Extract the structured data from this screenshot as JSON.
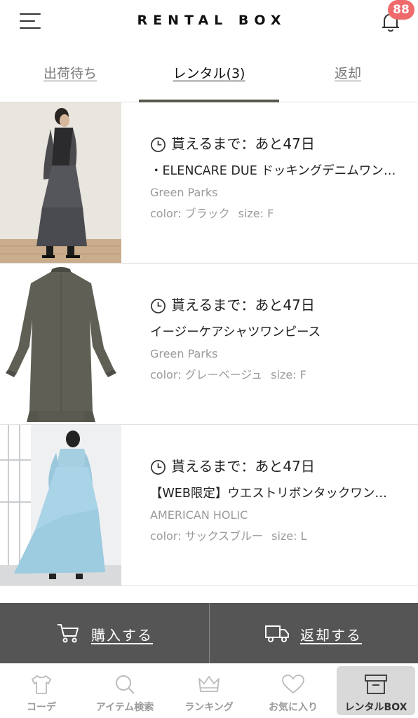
{
  "header": {
    "title": "RENTAL BOX",
    "notification_count": "88"
  },
  "tabs": [
    {
      "label": "出荷待ち"
    },
    {
      "label": "レンタル(3)"
    },
    {
      "label": "返却"
    }
  ],
  "items": [
    {
      "deadline": "貰えるまで：あと47日",
      "name": "・ELENCARE DUE ドッキングデニムワンピース",
      "brand": "Green Parks",
      "color": "color: ブラック",
      "size": "size: F"
    },
    {
      "deadline": "貰えるまで：あと47日",
      "name": "イージーケアシャツワンピース",
      "brand": "Green Parks",
      "color": "color: グレーベージュ",
      "size": "size: F"
    },
    {
      "deadline": "貰えるまで：あと47日",
      "name": "【WEB限定】ウエストリボンタックワンピース",
      "brand": "AMERICAN HOLIC",
      "color": "color: サックスブルー",
      "size": "size: L"
    }
  ],
  "actions": {
    "buy_label": "購入する",
    "return_label": "返却する"
  },
  "bottom_nav": [
    {
      "label": "コーデ",
      "icon": "tshirt-icon"
    },
    {
      "label": "アイテム検索",
      "icon": "search-icon"
    },
    {
      "label": "ランキング",
      "icon": "crown-icon"
    },
    {
      "label": "お気に入り",
      "icon": "heart-icon"
    },
    {
      "label": "レンタルBOX",
      "icon": "box-icon",
      "active": true
    }
  ],
  "colors": {
    "accent": "#555a4d",
    "badge": "#ef6b6b",
    "action_bar": "#555555"
  }
}
